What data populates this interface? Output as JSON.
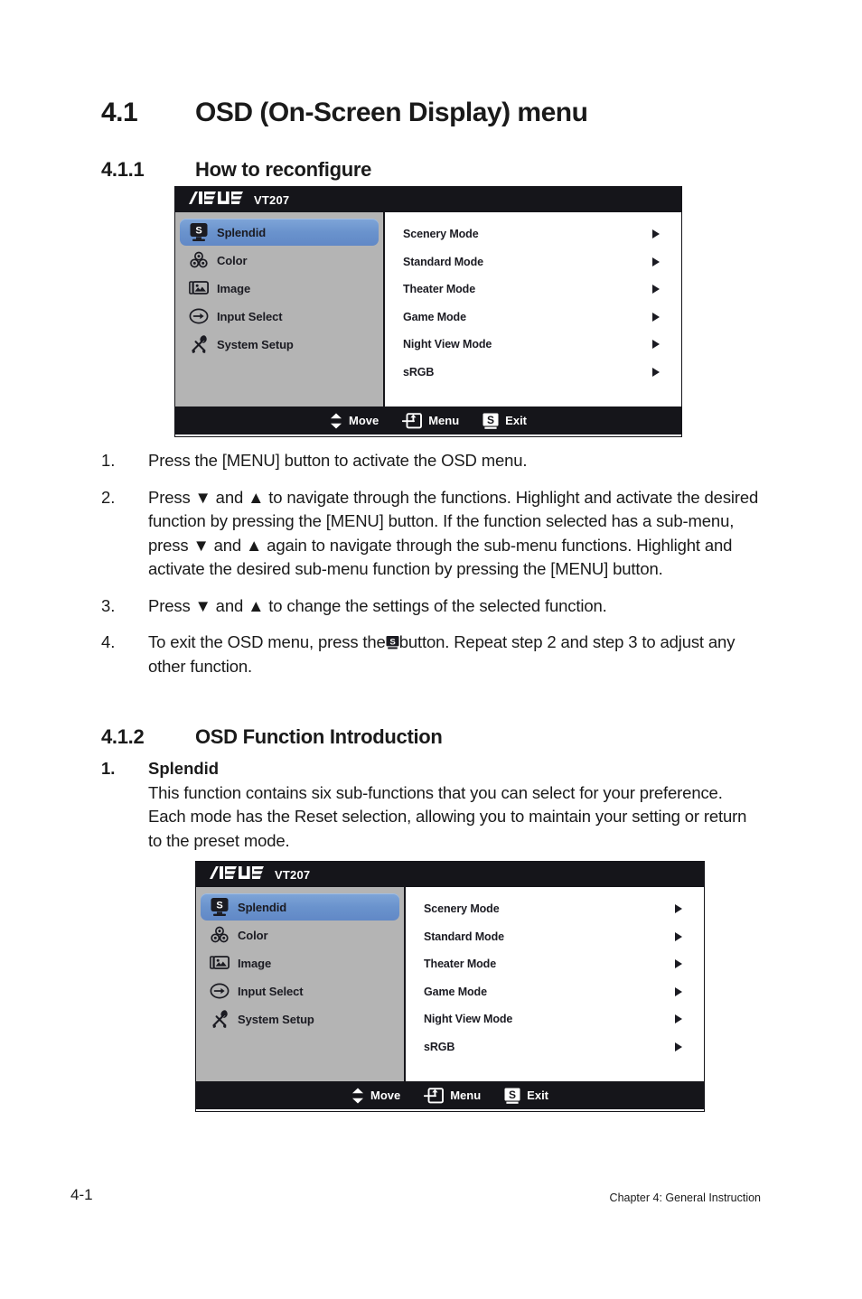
{
  "document": {
    "heading_main": {
      "number": "4.1",
      "title": "OSD (On-Screen Display) menu"
    },
    "heading_sub1": {
      "number": "4.1.1",
      "title": "How to reconfigure"
    },
    "heading_sub2": {
      "number": "4.1.2",
      "title": "OSD Function Introduction"
    },
    "footer": {
      "page_number": "4-1",
      "chapter": "Chapter 4: General Instruction"
    }
  },
  "steps": [
    {
      "number": "1.",
      "text": "Press the [MENU] button to activate the OSD menu."
    },
    {
      "number": "2.",
      "text": "Press ▼ and ▲ to navigate through the functions. Highlight and activate the desired function by pressing the [MENU] button. If the function selected has a sub-menu, press ▼ and ▲ again to navigate through the sub-menu functions. Highlight and activate the desired sub-menu function by pressing the [MENU] button."
    },
    {
      "number": "3.",
      "text": "Press ▼ and ▲ to change the settings of the selected function."
    },
    {
      "number": "4.",
      "text_before": "To exit the OSD menu, press the",
      "icon": "splendid-s-button-icon",
      "text_after": "button. Repeat step 2 and step 3 to adjust any other function."
    }
  ],
  "function_intro": {
    "number": "1.",
    "title": "Splendid",
    "body": "This function contains six sub-functions that you can select for your preference. Each mode has the Reset selection, allowing you to maintain your setting or return to the preset mode."
  },
  "osd": {
    "brand_logo": "asus-logo",
    "model": "VT207",
    "sidebar_items": [
      {
        "label": "Splendid",
        "icon": "splendid-monitor-s-icon",
        "selected": true
      },
      {
        "label": "Color",
        "icon": "color-circles-icon",
        "selected": false
      },
      {
        "label": "Image",
        "icon": "image-picture-icon",
        "selected": false
      },
      {
        "label": "Input Select",
        "icon": "input-arrow-circle-icon",
        "selected": false
      },
      {
        "label": "System Setup",
        "icon": "tools-cross-icon",
        "selected": false
      }
    ],
    "options": [
      {
        "label": "Scenery Mode",
        "arrow": "chevron-right-icon"
      },
      {
        "label": "Standard Mode",
        "arrow": "chevron-right-icon"
      },
      {
        "label": "Theater Mode",
        "arrow": "chevron-right-icon"
      },
      {
        "label": "Game Mode",
        "arrow": "chevron-right-icon"
      },
      {
        "label": "Night View Mode",
        "arrow": "chevron-right-icon"
      },
      {
        "label": "sRGB",
        "arrow": "chevron-right-icon"
      }
    ],
    "footer_actions": [
      {
        "label": "Move",
        "icon": "up-down-arrows-icon"
      },
      {
        "label": "Menu",
        "icon": "menu-enter-icon"
      },
      {
        "label": "Exit",
        "icon": "splendid-s-button-icon"
      }
    ],
    "colors": {
      "titlebar": "#15151a",
      "sidebar": "#b4b4b4",
      "panel": "#ffffff",
      "selection": "#6d97d1",
      "text_dark": "#1b1b22",
      "text_light": "#ffffff"
    }
  }
}
